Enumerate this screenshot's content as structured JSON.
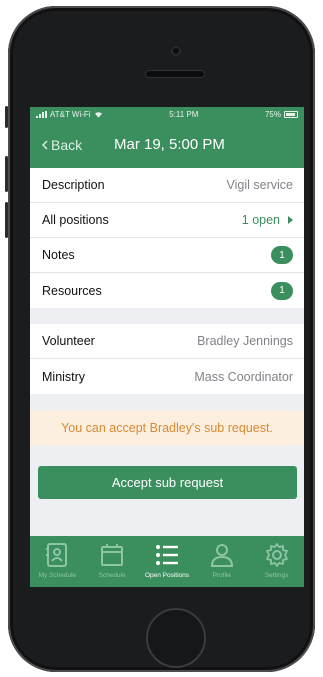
{
  "status_bar": {
    "carrier": "AT&T Wi-Fi",
    "time": "5:11 PM",
    "battery": "75%"
  },
  "nav": {
    "back_label": "Back",
    "title": "Mar 19, 5:00 PM"
  },
  "details": {
    "description_label": "Description",
    "description_value": "Vigil service",
    "positions_label": "All positions",
    "positions_value": "1 open",
    "notes_label": "Notes",
    "notes_count": "1",
    "resources_label": "Resources",
    "resources_count": "1"
  },
  "assignment": {
    "volunteer_label": "Volunteer",
    "volunteer_value": "Bradley Jennings",
    "ministry_label": "Ministry",
    "ministry_value": "Mass Coordinator"
  },
  "notice": "You can accept Bradley's sub request.",
  "accept_button": "Accept sub request",
  "tabs": [
    {
      "label": "My Schedule",
      "icon": "contact-card-icon"
    },
    {
      "label": "Schedule",
      "icon": "calendar-icon"
    },
    {
      "label": "Open Positions",
      "icon": "list-icon"
    },
    {
      "label": "Profile",
      "icon": "person-icon"
    },
    {
      "label": "Settings",
      "icon": "gear-icon"
    }
  ],
  "colors": {
    "brand_green": "#3b8e5e",
    "notice_bg": "#fcefdf",
    "notice_text": "#d98a34"
  }
}
